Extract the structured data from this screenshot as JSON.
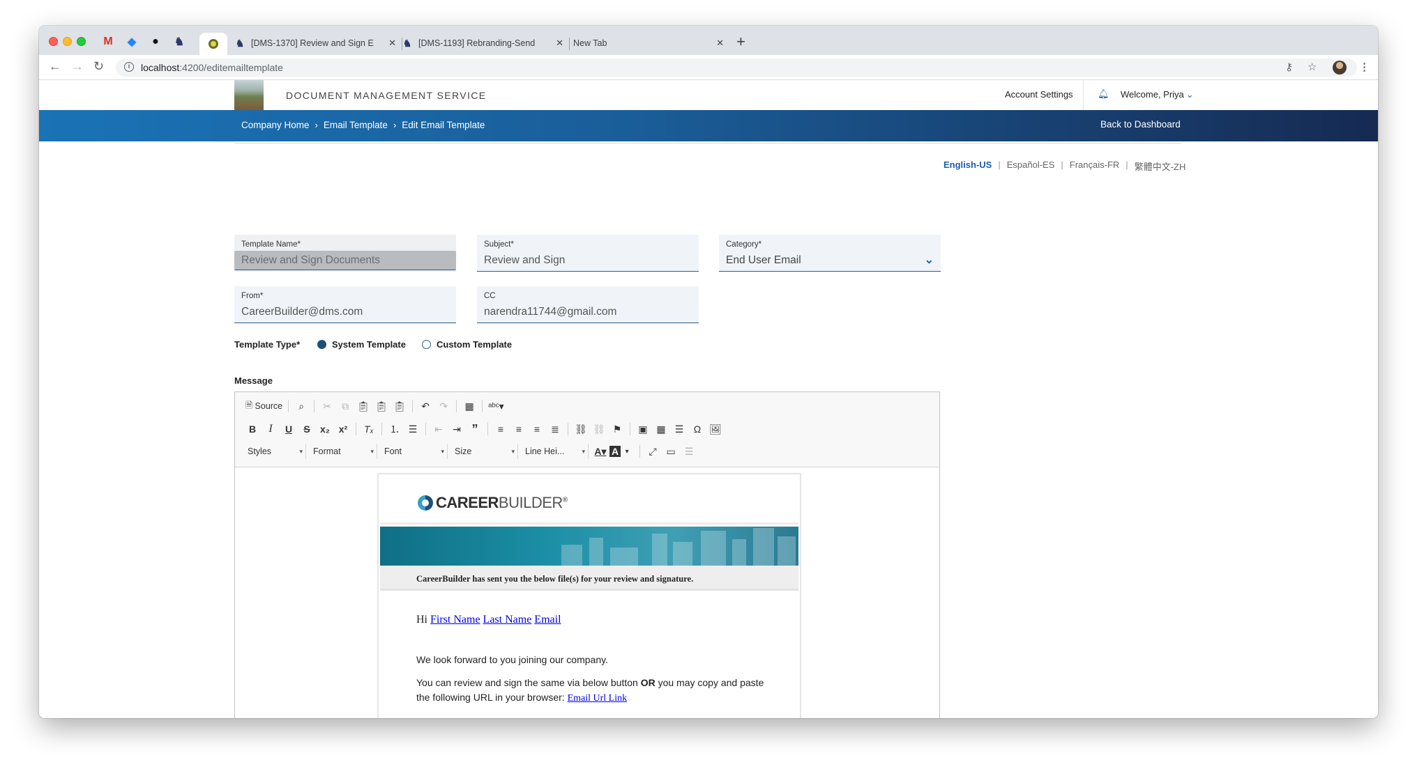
{
  "browser": {
    "tabs": [
      {
        "title": "[DMS-1370] Review and Sign E"
      },
      {
        "title": "[DMS-1193] Rebranding-Send"
      },
      {
        "title": "New Tab"
      }
    ],
    "url_host": "localhost",
    "url_path": ":4200/editemailtemplate"
  },
  "header": {
    "app_title": "DOCUMENT MANAGEMENT SERVICE",
    "account_settings": "Account Settings",
    "welcome": "Welcome, Priya"
  },
  "breadcrumb": {
    "items": [
      "Company Home",
      "Email Template",
      "Edit Email Template"
    ],
    "back": "Back to Dashboard"
  },
  "languages": {
    "items": [
      "English-US",
      "Español-ES",
      "Français-FR",
      "繁體中文-ZH"
    ],
    "active": "English-US"
  },
  "form": {
    "template_name": {
      "label": "Template Name*",
      "value": "Review and Sign Documents"
    },
    "subject": {
      "label": "Subject*",
      "value": "Review and Sign"
    },
    "category": {
      "label": "Category*",
      "value": "End User Email"
    },
    "from": {
      "label": "From*",
      "value": "CareerBuilder@dms.com"
    },
    "cc": {
      "label": "CC",
      "value": "narendra11744@gmail.com"
    },
    "template_type": {
      "label": "Template Type*",
      "options": [
        "System Template",
        "Custom Template"
      ],
      "selected": "System Template"
    },
    "message_label": "Message"
  },
  "editor": {
    "source_label": "Source",
    "combos": [
      "Styles",
      "Format",
      "Font",
      "Size",
      "Line Hei..."
    ]
  },
  "email": {
    "brand_bold": "CAREER",
    "brand_light": "BUILDER",
    "brand_reg": "®",
    "sent_line": "CareerBuilder has sent you the below file(s) for your review and signature.",
    "hi": "Hi",
    "first_name": "First Name",
    "last_name": "Last Name",
    "email_tag": "Email",
    "p1": "We look forward to you joining our company.",
    "p2_a": "You can review and sign the same via below button",
    "p2_or": "OR",
    "p2_b": "you may copy and paste the following URL in your browser:",
    "url_link": "Email Url Link"
  }
}
